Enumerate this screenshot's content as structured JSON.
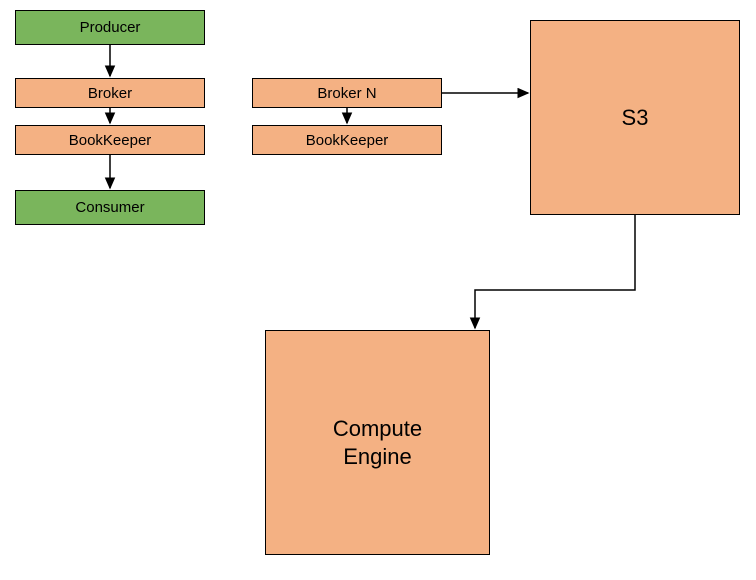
{
  "nodes": {
    "producer": {
      "label": "Producer"
    },
    "broker1": {
      "label": "Broker"
    },
    "brokerN": {
      "label": "Broker N"
    },
    "bookkeeper1": {
      "label": "BookKeeper"
    },
    "bookkeeperN": {
      "label": "BookKeeper"
    },
    "consumer": {
      "label": "Consumer"
    },
    "s3": {
      "label": "S3"
    },
    "computeEngine": {
      "label": "Compute\nEngine"
    }
  }
}
